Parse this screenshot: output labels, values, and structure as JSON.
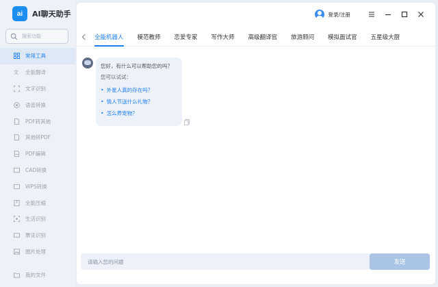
{
  "app": {
    "logo_text": "ai",
    "name": "AI聊天助手"
  },
  "sidebar": {
    "search_placeholder": "搜索功能",
    "items": [
      {
        "label": "常用工具",
        "icon": "grid-icon",
        "active": true
      },
      {
        "label": "全能翻译",
        "icon": "translate-icon"
      },
      {
        "label": "文字识别",
        "icon": "text-scan-icon"
      },
      {
        "label": "语音转换",
        "icon": "voice-icon"
      },
      {
        "label": "PDF转其他",
        "icon": "pdf-export-icon"
      },
      {
        "label": "其他转PDF",
        "icon": "pdf-import-icon"
      },
      {
        "label": "PDF编辑",
        "icon": "pdf-edit-icon"
      },
      {
        "label": "CAD转换",
        "icon": "cad-icon"
      },
      {
        "label": "WPS转换",
        "icon": "wps-icon"
      },
      {
        "label": "全能压缩",
        "icon": "compress-icon"
      },
      {
        "label": "生活识别",
        "icon": "life-scan-icon"
      },
      {
        "label": "票证识别",
        "icon": "ticket-icon"
      },
      {
        "label": "图片处理",
        "icon": "image-icon"
      }
    ],
    "footer_label": "我的文件"
  },
  "topbar": {
    "login_label": "登录/注册"
  },
  "tabs": [
    "全能机器人",
    "模范教师",
    "恋爱专家",
    "写作大师",
    "高级翻译官",
    "旅游顾问",
    "模拟面试官",
    "五星级大厨"
  ],
  "chat": {
    "greeting": "您好，有什么可以帮助您的吗？",
    "try_label": "您可以试试：",
    "suggestions": [
      "外星人真的存在吗？",
      "情人节送什么礼物？",
      "怎么养宠物？"
    ]
  },
  "input": {
    "placeholder": "请输入您的问题",
    "send_label": "发送"
  },
  "colors": {
    "accent": "#1d7ff0",
    "send_button": "#a9c4e4",
    "bubble": "#edf2fa"
  }
}
